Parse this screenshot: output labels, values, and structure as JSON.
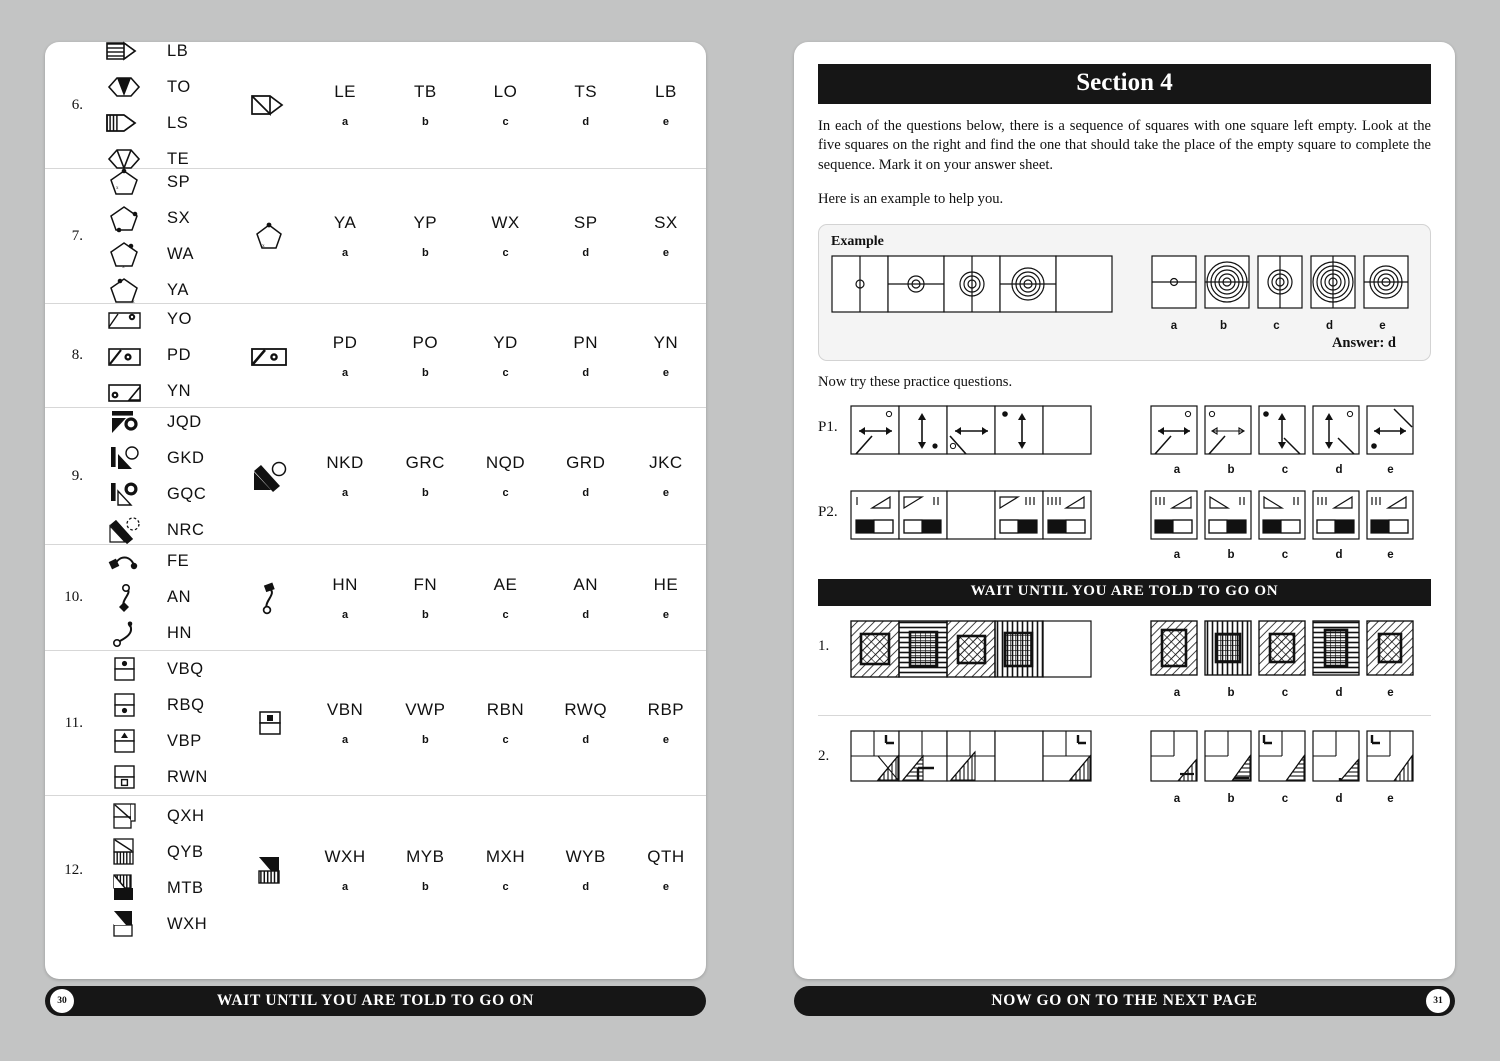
{
  "document": {
    "left_page_number": "30",
    "right_page_number": "31",
    "left_footer": "WAIT UNTIL YOU ARE TOLD TO GO ON",
    "right_footer": "NOW GO ON TO THE NEXT PAGE"
  },
  "left_page": {
    "questions": [
      {
        "number": "6.",
        "key_codes": [
          "LB",
          "TO",
          "LS",
          "TE"
        ],
        "options": [
          "LE",
          "TB",
          "LO",
          "TS",
          "LB"
        ],
        "option_letters": [
          "a",
          "b",
          "c",
          "d",
          "e"
        ]
      },
      {
        "number": "7.",
        "key_codes": [
          "SP",
          "SX",
          "WA",
          "YA"
        ],
        "options": [
          "YA",
          "YP",
          "WX",
          "SP",
          "SX"
        ],
        "option_letters": [
          "a",
          "b",
          "c",
          "d",
          "e"
        ]
      },
      {
        "number": "8.",
        "key_codes": [
          "YO",
          "PD",
          "YN"
        ],
        "options": [
          "PD",
          "PO",
          "YD",
          "PN",
          "YN"
        ],
        "option_letters": [
          "a",
          "b",
          "c",
          "d",
          "e"
        ]
      },
      {
        "number": "9.",
        "key_codes": [
          "JQD",
          "GKD",
          "GQC",
          "NRC"
        ],
        "options": [
          "NKD",
          "GRC",
          "NQD",
          "GRD",
          "JKC"
        ],
        "option_letters": [
          "a",
          "b",
          "c",
          "d",
          "e"
        ]
      },
      {
        "number": "10.",
        "key_codes": [
          "FE",
          "AN",
          "HN"
        ],
        "options": [
          "HN",
          "FN",
          "AE",
          "AN",
          "HE"
        ],
        "option_letters": [
          "a",
          "b",
          "c",
          "d",
          "e"
        ]
      },
      {
        "number": "11.",
        "key_codes": [
          "VBQ",
          "RBQ",
          "VBP",
          "RWN"
        ],
        "options": [
          "VBN",
          "VWP",
          "RBN",
          "RWQ",
          "RBP"
        ],
        "option_letters": [
          "a",
          "b",
          "c",
          "d",
          "e"
        ]
      },
      {
        "number": "12.",
        "key_codes": [
          "QXH",
          "QYB",
          "MTB",
          "WXH"
        ],
        "options": [
          "WXH",
          "MYB",
          "MXH",
          "WYB",
          "QTH"
        ],
        "option_letters": [
          "a",
          "b",
          "c",
          "d",
          "e"
        ]
      }
    ]
  },
  "right_page": {
    "section_title": "Section 4",
    "intro_paragraph": "In each of the questions below, there is a sequence of squares with one square left empty. Look at the five squares on the right and find the one that should take the place of the empty square to complete the sequence. Mark it on your answer sheet.",
    "example_lead": "Here is an example to help you.",
    "example_label": "Example",
    "example_answer": "Answer: d",
    "practice_lead": "Now try these practice questions.",
    "practice": [
      {
        "label": "P1.",
        "option_letters": [
          "a",
          "b",
          "c",
          "d",
          "e"
        ]
      },
      {
        "label": "P2.",
        "option_letters": [
          "a",
          "b",
          "c",
          "d",
          "e"
        ]
      }
    ],
    "wait_banner": "WAIT UNTIL YOU ARE TOLD TO GO ON",
    "questions": [
      {
        "number": "1.",
        "option_letters": [
          "a",
          "b",
          "c",
          "d",
          "e"
        ]
      },
      {
        "number": "2.",
        "option_letters": [
          "a",
          "b",
          "c",
          "d",
          "e"
        ]
      }
    ],
    "example_option_letters": [
      "a",
      "b",
      "c",
      "d",
      "e"
    ]
  },
  "colors": {
    "page_background": "#c3c4c4",
    "paper": "#ffffff",
    "banner": "#161616",
    "ink": "#111111",
    "example_panel": "#f4f4f4"
  }
}
